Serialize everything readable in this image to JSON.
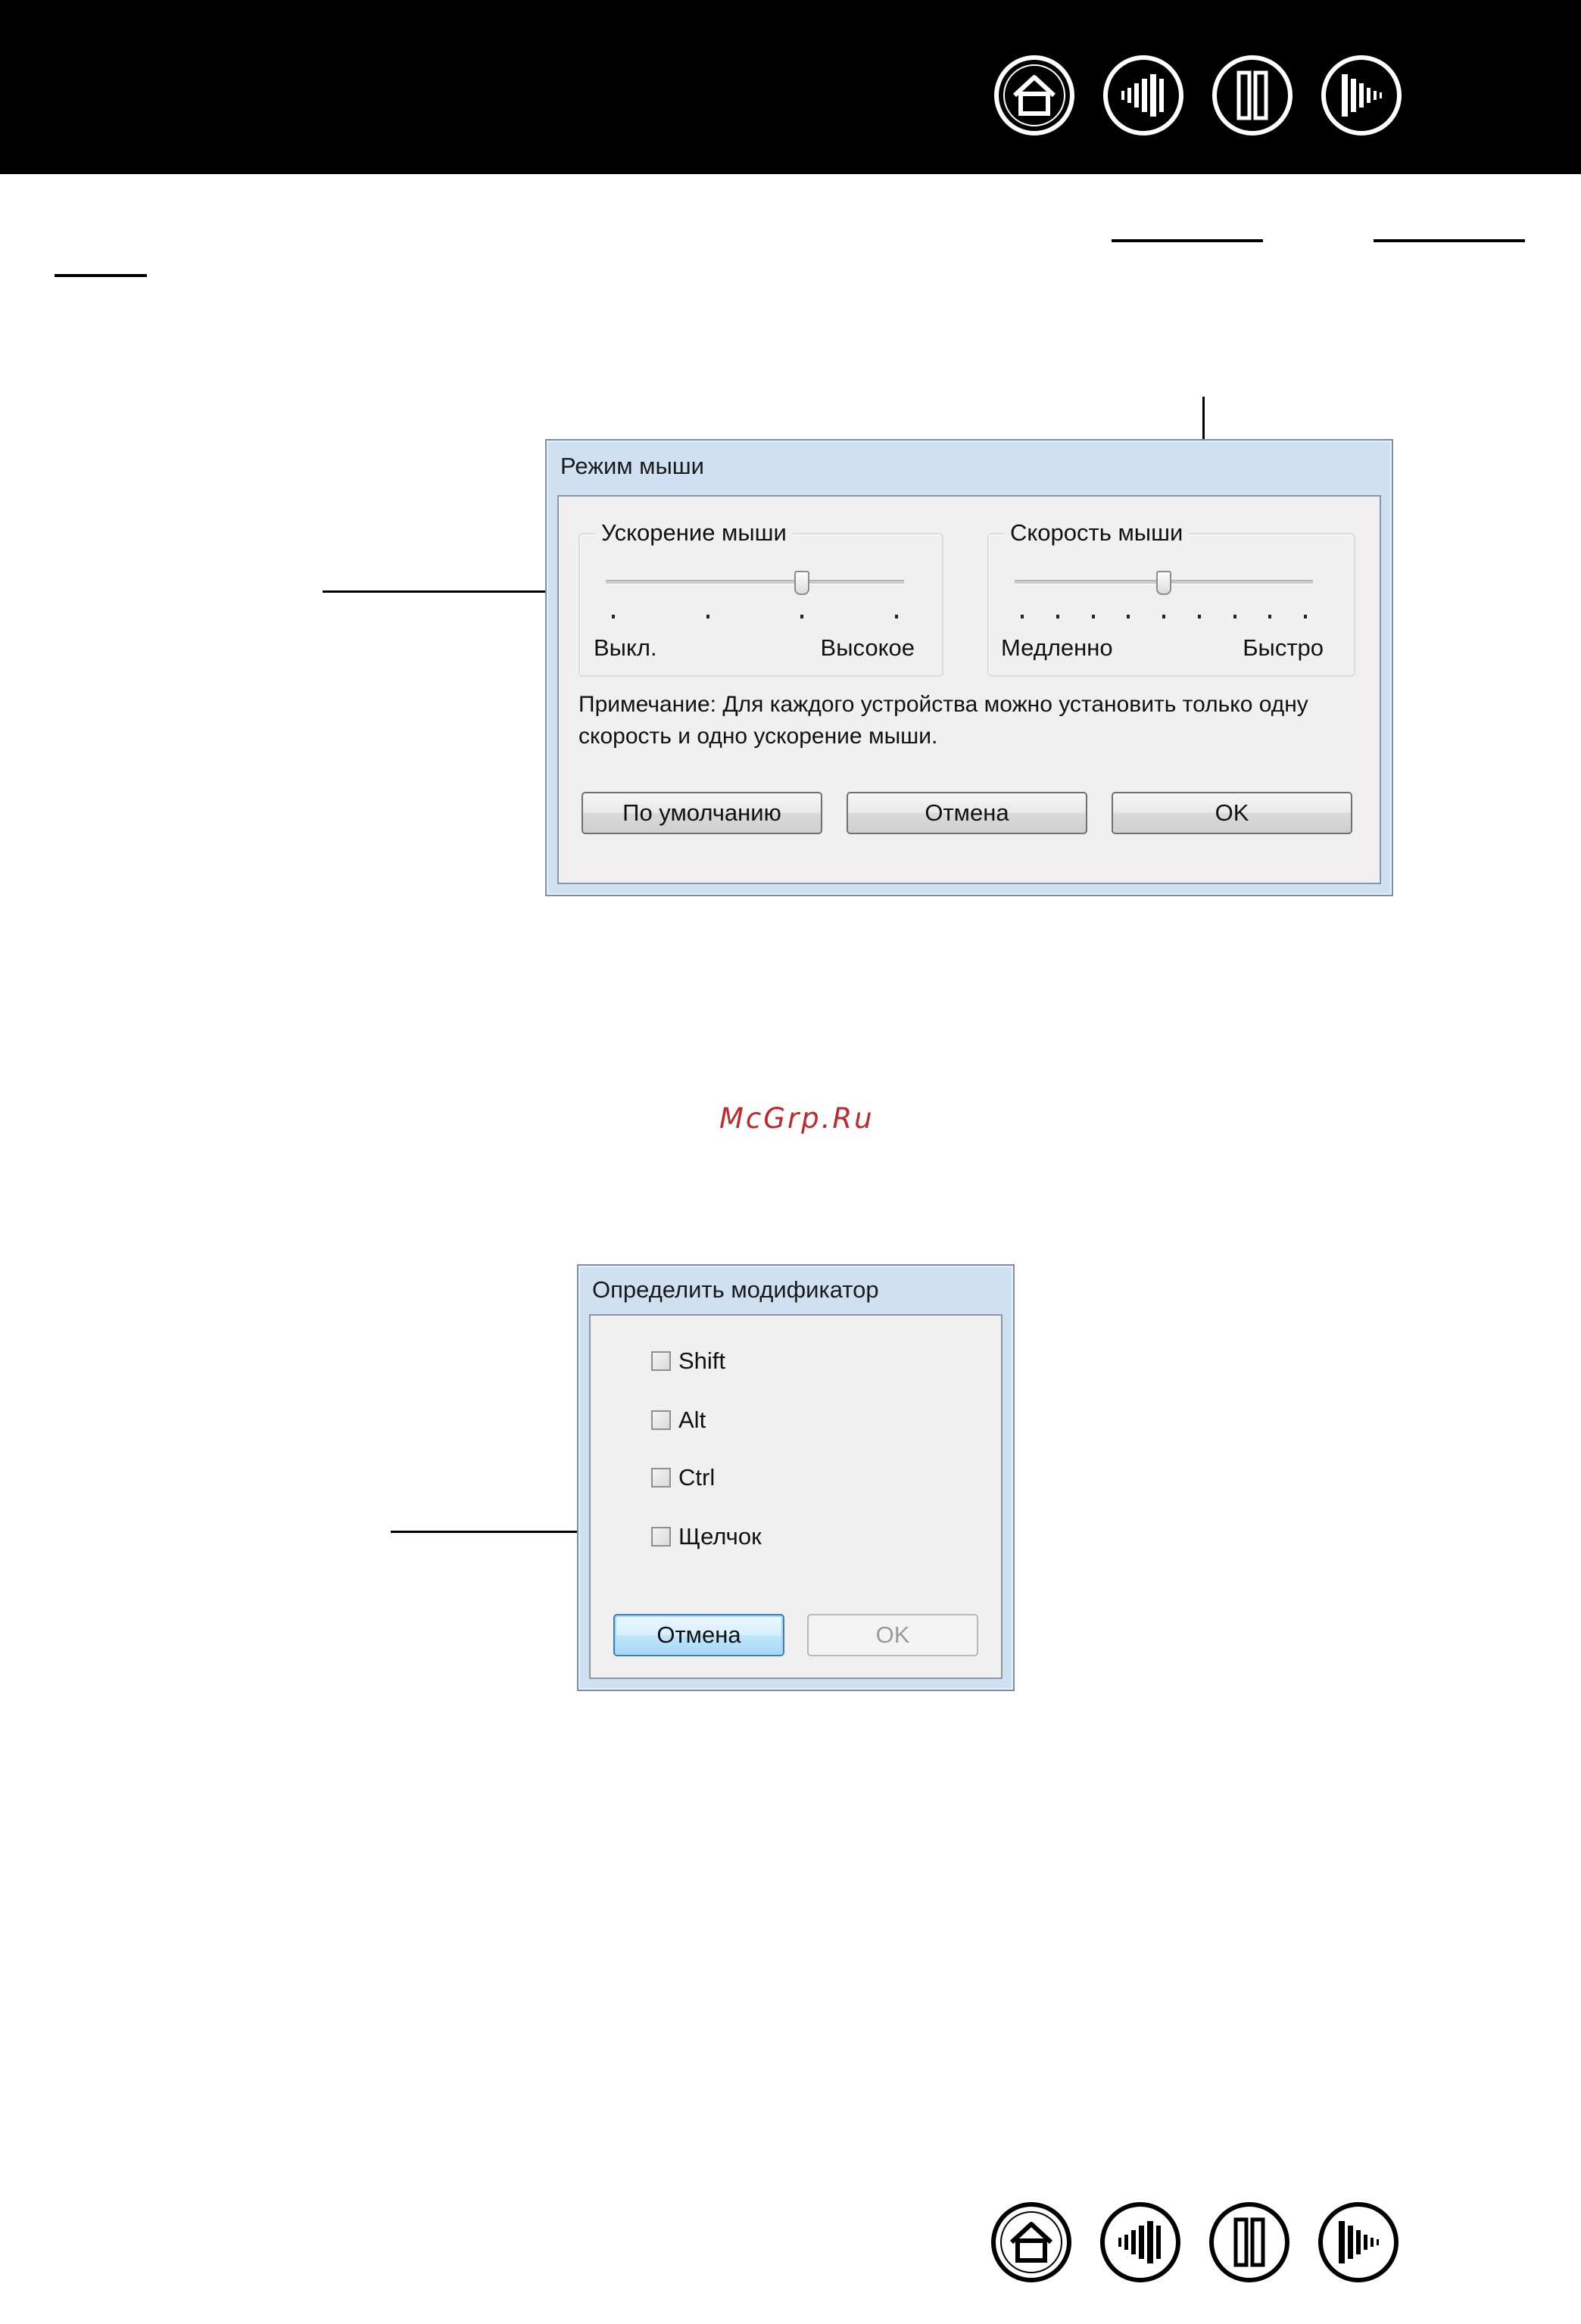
{
  "nav": {
    "top": [
      "home-icon",
      "contents-icon",
      "index-icon",
      "next-icon"
    ],
    "bottom": [
      "home-icon",
      "contents-icon",
      "index-icon",
      "next-icon"
    ]
  },
  "mouse_mode_dialog": {
    "title": "Режим мыши",
    "acceleration": {
      "group_label": "Ускорение мыши",
      "min_label": "Выкл.",
      "max_label": "Высокое",
      "tick_count": 4,
      "value_tick": 2
    },
    "speed": {
      "group_label": "Скорость мыши",
      "min_label": "Медленно",
      "max_label": "Быстро",
      "tick_count": 9,
      "value_tick": 4
    },
    "note": "Примечание: Для каждого устройства можно установить только одну скорость и одно ускорение мыши.",
    "buttons": {
      "default": "По умолчанию",
      "cancel": "Отмена",
      "ok": "OK"
    }
  },
  "watermark": "McGrp.Ru",
  "modifier_dialog": {
    "title": "Определить модификатор",
    "options": [
      {
        "label": "Shift",
        "checked": false
      },
      {
        "label": "Alt",
        "checked": false
      },
      {
        "label": "Ctrl",
        "checked": false
      },
      {
        "label": "Щелчок",
        "checked": false
      }
    ],
    "buttons": {
      "cancel": "Отмена",
      "ok": "OK"
    }
  }
}
